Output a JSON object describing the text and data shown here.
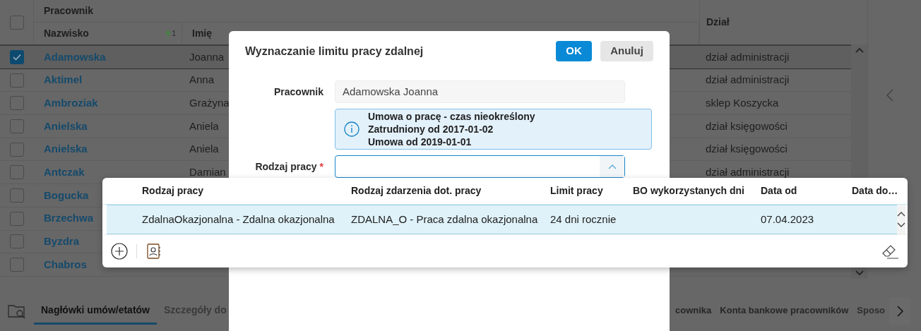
{
  "table": {
    "group_header": "Pracownik",
    "select_all_checked": false,
    "columns": [
      {
        "label": "Nazwisko",
        "sort_ascending": true,
        "sort_index": "1"
      },
      {
        "label": "Imię"
      },
      {
        "label": "Dział"
      }
    ],
    "rows": [
      {
        "checked": true,
        "selected": true,
        "surname": "Adamowska",
        "first_name": "Joanna",
        "department": "dział administracji"
      },
      {
        "checked": false,
        "selected": false,
        "surname": "Aktimel",
        "first_name": "Anna",
        "department": "dział administracji"
      },
      {
        "checked": false,
        "selected": false,
        "surname": "Ambroziak",
        "first_name": "Grażyna",
        "department": "sklep Koszycka"
      },
      {
        "checked": false,
        "selected": false,
        "surname": "Anielska",
        "first_name": "Aniela",
        "department": "dział księgowości"
      },
      {
        "checked": false,
        "selected": false,
        "surname": "Anielska",
        "first_name": "Aniela",
        "department": "dział księgowości"
      },
      {
        "checked": false,
        "selected": false,
        "surname": "Antczak",
        "first_name": "Damian",
        "department": "dział administracji"
      },
      {
        "checked": false,
        "selected": false,
        "surname": "Bogucka"
      },
      {
        "checked": false,
        "selected": false,
        "surname": "Brzechwa"
      },
      {
        "checked": false,
        "selected": false,
        "surname": "Byzdra"
      },
      {
        "checked": false,
        "selected": false,
        "surname": "Chabros"
      }
    ]
  },
  "bottom_tabs": {
    "left": [
      {
        "label": "Nagłówki umów/etatów",
        "selected": true
      },
      {
        "label": "Szczegóły do",
        "selected": false
      }
    ],
    "right": [
      {
        "label": "cownika",
        "selected": false
      },
      {
        "label": "Konta bankowe pracowników",
        "selected": false
      },
      {
        "label": "Sposo",
        "selected": false
      }
    ]
  },
  "dialog": {
    "title": "Wyznaczanie limitu pracy zdalnej",
    "buttons": [
      {
        "label": "OK",
        "kind": "primary"
      },
      {
        "label": "Anuluj",
        "kind": "secondary"
      }
    ],
    "fields": [
      {
        "kind": "readonly",
        "label": "Pracownik",
        "value": "Adamowska Joanna"
      },
      {
        "kind": "info",
        "lines": [
          "Umowa o pracę - czas nieokreślony",
          "Zatrudniony od 2017-01-02",
          "Umowa od 2019-01-01"
        ]
      },
      {
        "kind": "select",
        "label": "Rodzaj pracy",
        "required_mark": "*",
        "expanded": true
      }
    ]
  },
  "dropdown": {
    "columns": [
      "Rodzaj pracy",
      "Rodzaj zdarzenia dot. pracy",
      "Limit pracy",
      "BO wykorzystanych dni",
      "Data od",
      "Data do…"
    ],
    "rows": [
      {
        "selected": true,
        "cells": [
          "ZdalnaOkazjonalna - Zdalna okazjonalna",
          "ZDALNA_O - Praca zdalna okazjonalna",
          "24 dni rocznie",
          "",
          "07.04.2023",
          ""
        ]
      }
    ]
  }
}
